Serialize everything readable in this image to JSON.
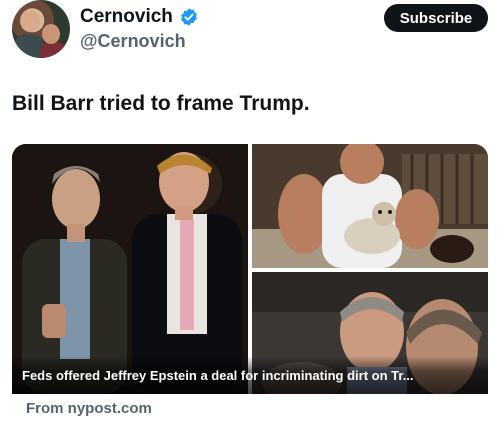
{
  "author": {
    "display_name": "Cernovich",
    "handle": "@Cernovich",
    "verified": true,
    "verified_color": "#1d9bf0"
  },
  "subscribe_button": {
    "label": "Subscribe"
  },
  "tweet": {
    "text": "Bill Barr tried to frame Trump."
  },
  "link_card": {
    "headline": "Feds offered Jeffrey Epstein a deal for incriminating dirt on Tr...",
    "source": "From nypost.com"
  },
  "colors": {
    "text_primary": "#0f1419",
    "text_secondary": "#536471",
    "button_bg": "#0f1419",
    "button_text": "#ffffff"
  }
}
